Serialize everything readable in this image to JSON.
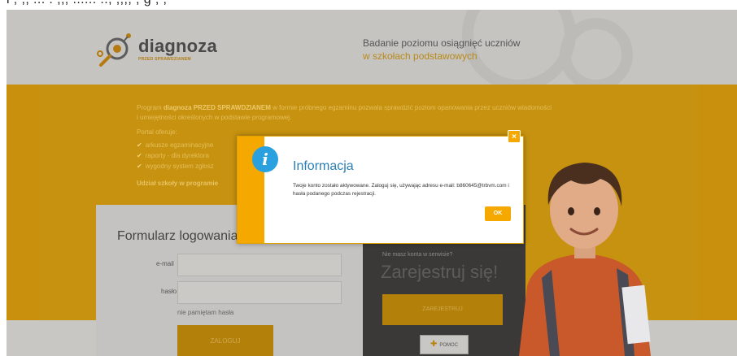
{
  "top_strip_text": "l ; ;, ... . ;;; ...... ..; ;;;; ; g ; ;",
  "header": {
    "logo_text": "diagnoza",
    "logo_sub": "PRZED SPRAWDZIANEM",
    "tagline_line1": "Badanie poziomu osiągnięć uczniów",
    "tagline_line2": "w szkołach podstawowych"
  },
  "band": {
    "intro_line1_prefix": "Program ",
    "intro_line1_brand": "diagnoza PRZED SPRAWDZIANEM",
    "intro_line1_rest": " w formie próbnego egzaminu pozwala sprawdzić poziom opanowania przez uczniów wiadomości",
    "intro_line2": "i umiejętności określonych w podstawie programowej.",
    "offers_label": "Portal oferuje:",
    "offers": [
      "arkusze egzaminacyjne",
      "raporty - dla dyrektora",
      "wygodny system zgłosz"
    ],
    "participation": "Udział szkoły w programie"
  },
  "login": {
    "title": "Formularz logowania",
    "email_label": "e-mail",
    "email_value": "",
    "password_label": "hasło",
    "password_value": "",
    "forgot_label": "nie pamiętam hasła",
    "submit_label": "ZALOGUJ"
  },
  "register": {
    "question": "Nie masz konta w serwisie?",
    "title": "Zarejestruj się!",
    "button_label": "ZAREJESTRUJ",
    "help_label": "POMOC"
  },
  "modal": {
    "title": "Informacja",
    "body": "Twoje konto zostało aktywowane. Zaloguj się, używając adresu e-mail: b860645@trbvm.com i hasła podanego podczas rejestracji.",
    "ok_label": "OK",
    "close_label": "×"
  },
  "colors": {
    "accent": "#f5a800",
    "info_blue": "#2aa1de",
    "title_blue": "#2a7fb5"
  }
}
